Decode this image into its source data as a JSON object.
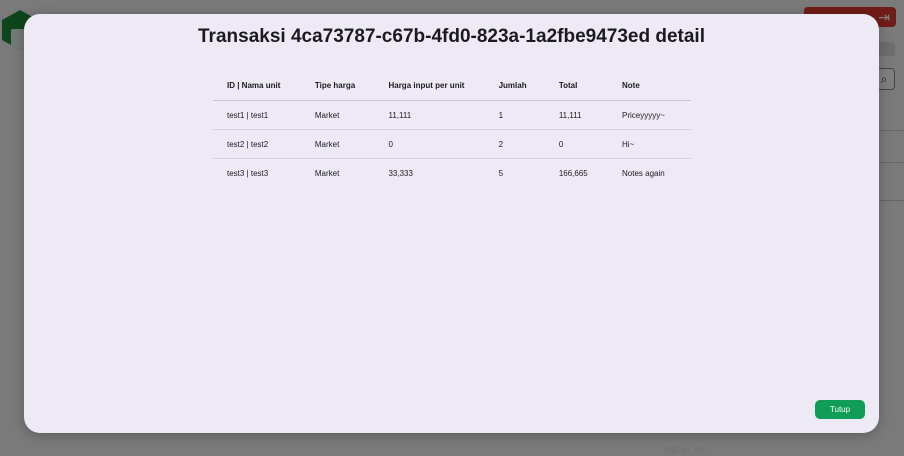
{
  "modal": {
    "title": "Transaksi 4ca73787-c67b-4fd0-823a-1a2fbe9473ed detail",
    "close_label": "Tutup"
  },
  "table": {
    "headers": [
      "ID | Nama unit",
      "Tipe harga",
      "Harga input per unit",
      "Jumlah",
      "Total",
      "Note"
    ],
    "rows": [
      [
        "test1 | test1",
        "Market",
        "11,111",
        "1",
        "11,111",
        "Priceyyyyy~"
      ],
      [
        "test2 | test2",
        "Market",
        "0",
        "2",
        "0",
        "Hi~"
      ],
      [
        "test3 | test3",
        "Market",
        "33,333",
        "5",
        "166,665",
        "Notes again"
      ]
    ]
  },
  "background": {
    "footer_text": "WIB    en_ID ;",
    "logout_icon": "logout-icon",
    "search_icon": "search-icon"
  }
}
